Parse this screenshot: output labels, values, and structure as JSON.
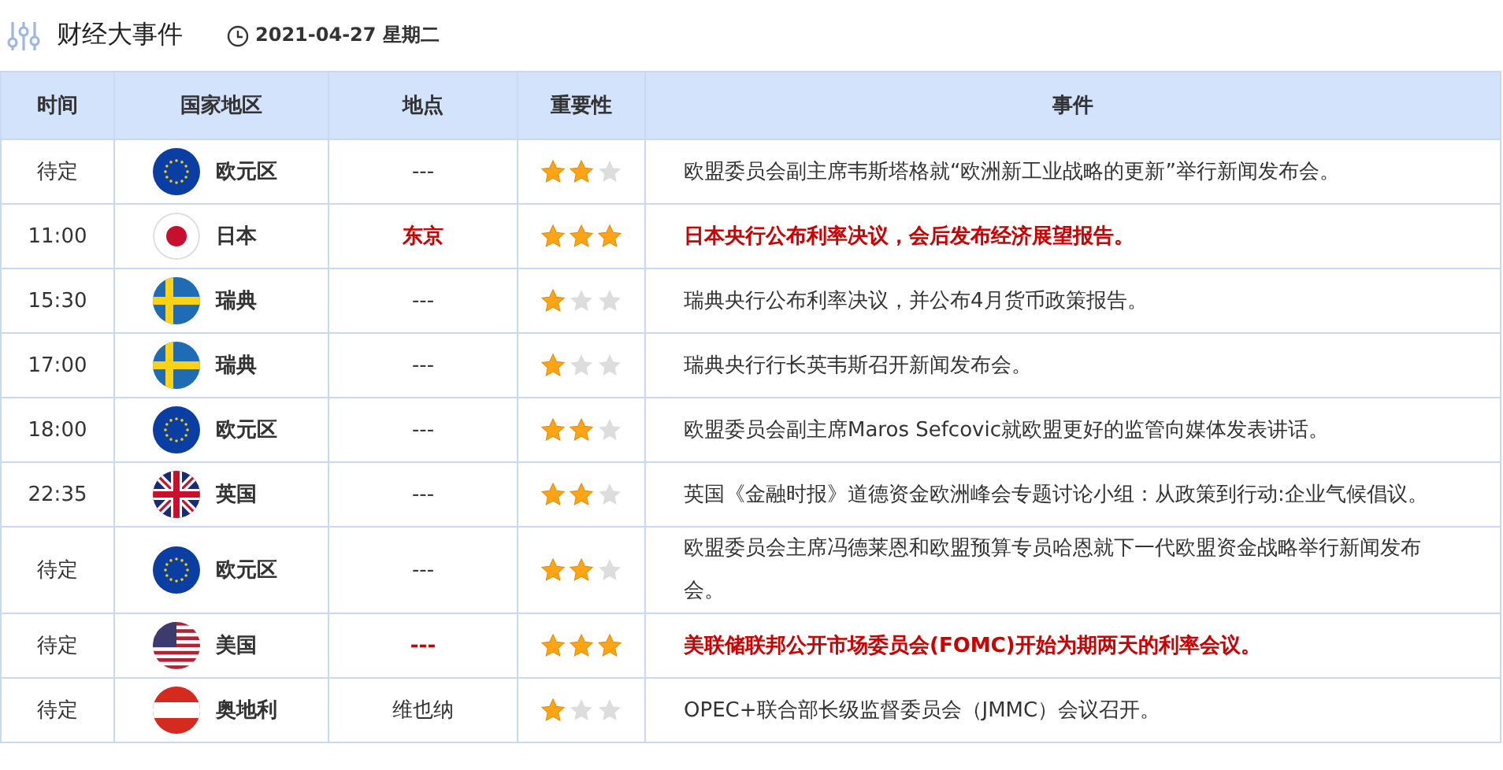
{
  "header": {
    "title": "财经大事件",
    "date": "2021-04-27 星期二"
  },
  "table": {
    "columns": [
      "时间",
      "国家地区",
      "地点",
      "重要性",
      "事件"
    ],
    "rows": [
      {
        "time": "待定",
        "kind": "eu",
        "country": "欧元区",
        "location": "---",
        "stars": 2,
        "important": false,
        "event": "欧盟委员会副主席韦斯塔格就“欧洲新工业战略的更新”举行新闻发布会。"
      },
      {
        "time": "11:00",
        "kind": "jp",
        "country": "日本",
        "location": "东京",
        "stars": 3,
        "important": true,
        "event": "日本央行公布利率决议，会后发布经济展望报告。"
      },
      {
        "time": "15:30",
        "kind": "se",
        "country": "瑞典",
        "location": "---",
        "stars": 1,
        "important": false,
        "event": "瑞典央行公布利率决议，并公布4月货币政策报告。"
      },
      {
        "time": "17:00",
        "kind": "se",
        "country": "瑞典",
        "location": "---",
        "stars": 1,
        "important": false,
        "event": "瑞典央行行长英韦斯召开新闻发布会。"
      },
      {
        "time": "18:00",
        "kind": "eu",
        "country": "欧元区",
        "location": "---",
        "stars": 2,
        "important": false,
        "event": "欧盟委员会副主席Maros Sefcovic就欧盟更好的监管向媒体发表讲话。"
      },
      {
        "time": "22:35",
        "kind": "gb",
        "country": "英国",
        "location": "---",
        "stars": 2,
        "important": false,
        "event": "英国《金融时报》道德资金欧洲峰会专题讨论小组：从政策到行动:企业气候倡议。"
      },
      {
        "time": "待定",
        "kind": "eu",
        "country": "欧元区",
        "location": "---",
        "stars": 2,
        "important": false,
        "event": "欧盟委员会主席冯德莱恩和欧盟预算专员哈恩就下一代欧盟资金战略举行新闻发布会。"
      },
      {
        "time": "待定",
        "kind": "us",
        "country": "美国",
        "location": "---",
        "stars": 3,
        "important": true,
        "event": "美联储联邦公开市场委员会(FOMC)开始为期两天的利率会议。"
      },
      {
        "time": "待定",
        "kind": "at",
        "country": "奥地利",
        "location": "维也纳",
        "stars": 1,
        "important": false,
        "event": "OPEC+联合部长级监督委员会（JMMC）会议召开。"
      }
    ]
  }
}
